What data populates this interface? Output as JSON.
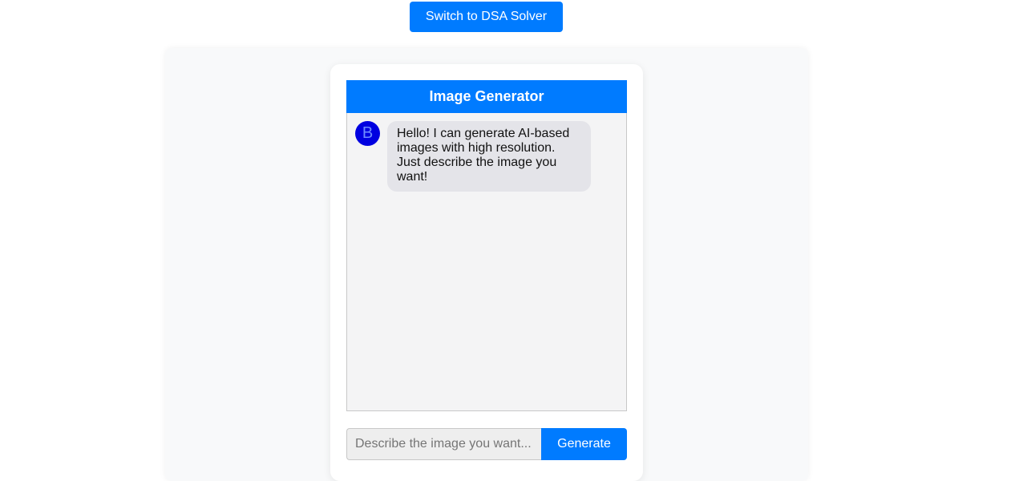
{
  "top_bar": {
    "switch_label": "Switch to DSA Solver"
  },
  "chat": {
    "title": "Image Generator",
    "messages": [
      {
        "sender": "bot",
        "avatar_letter": "B",
        "text": "Hello! I can generate AI-based images with high resolution. Just describe the image you want!"
      }
    ]
  },
  "composer": {
    "placeholder": "Describe the image you want...",
    "value": "",
    "generate_label": "Generate"
  },
  "colors": {
    "accent": "#007bff",
    "avatar": "#0000e0",
    "bubble": "#e4e4e9",
    "chat_bg": "#f4f4f5"
  }
}
